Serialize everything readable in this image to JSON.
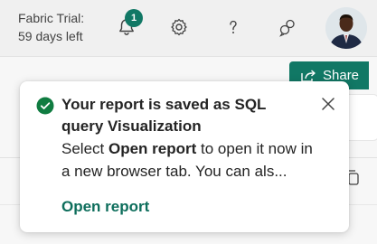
{
  "header": {
    "trial_line1": "Fabric Trial:",
    "trial_line2": "59 days left",
    "notification_count": "1",
    "icons": [
      "bell-icon",
      "gear-icon",
      "help-icon",
      "feedback-icon"
    ]
  },
  "toolbar": {
    "share_label": "Share"
  },
  "toast": {
    "title": "Your report is saved as SQL query Visualization",
    "body_prefix": "Select ",
    "body_bold": "Open report",
    "body_suffix": " to open it now in a new browser tab. You can als...",
    "link_label": "Open report"
  },
  "colors": {
    "brand": "#117865",
    "success": "#107c41",
    "link": "#0e6e5c"
  }
}
